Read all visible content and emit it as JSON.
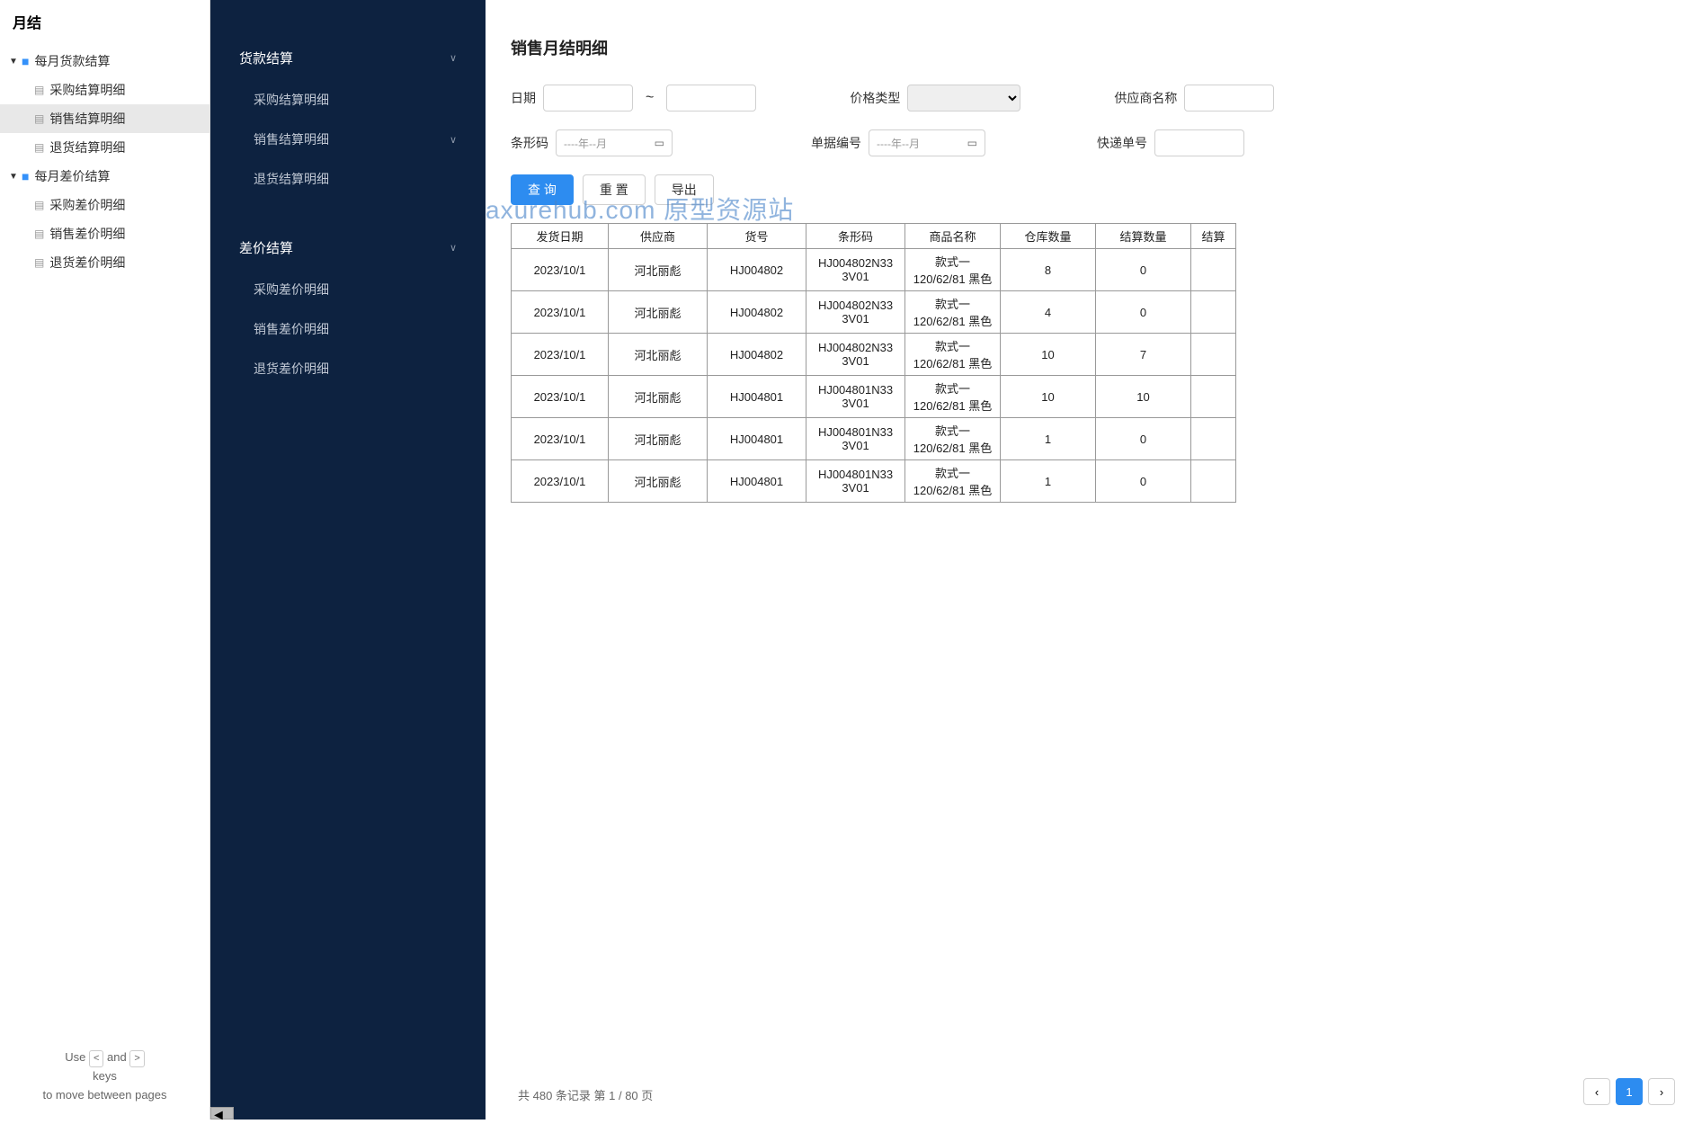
{
  "tree": {
    "title": "月结",
    "groups": [
      {
        "label": "每月货款结算",
        "items": [
          "采购结算明细",
          "销售结算明细",
          "退货结算明细"
        ]
      },
      {
        "label": "每月差价结算",
        "items": [
          "采购差价明细",
          "销售差价明细",
          "退货差价明细"
        ]
      }
    ],
    "footer": {
      "use": "Use",
      "and": "and",
      "keys": "keys",
      "hint": "to move between pages",
      "left": "<",
      "right": ">"
    }
  },
  "darkNav": {
    "section1": "货款结算",
    "items1": [
      "采购结算明细",
      "销售结算明细",
      "退货结算明细"
    ],
    "section2": "差价结算",
    "items2": [
      "采购差价明细",
      "销售差价明细",
      "退货差价明细"
    ]
  },
  "page": {
    "title": "销售月结明细",
    "filters": {
      "date": "日期",
      "tilde": "~",
      "priceType": "价格类型",
      "supplierName": "供应商名称",
      "barcode": "条形码",
      "barcodePh": "----年--月",
      "docNo": "单据编号",
      "docNoPh": "----年--月",
      "trackNo": "快递单号"
    },
    "buttons": {
      "query": "查 询",
      "reset": "重 置",
      "export": "导出"
    },
    "headers": [
      "发货日期",
      "供应商",
      "货号",
      "条形码",
      "商品名称",
      "仓库数量",
      "结算数量",
      "结算"
    ],
    "rows": [
      [
        "2023/10/1",
        "河北丽彪",
        "HJ004802",
        "HJ004802N333V01",
        "款式一 120/62/81 黑色",
        "8",
        "0"
      ],
      [
        "2023/10/1",
        "河北丽彪",
        "HJ004802",
        "HJ004802N333V01",
        "款式一 120/62/81 黑色",
        "4",
        "0"
      ],
      [
        "2023/10/1",
        "河北丽彪",
        "HJ004802",
        "HJ004802N333V01",
        "款式一 120/62/81 黑色",
        "10",
        "7"
      ],
      [
        "2023/10/1",
        "河北丽彪",
        "HJ004801",
        "HJ004801N333V01",
        "款式一 120/62/81 黑色",
        "10",
        "10"
      ],
      [
        "2023/10/1",
        "河北丽彪",
        "HJ004801",
        "HJ004801N333V01",
        "款式一 120/62/81 黑色",
        "1",
        "0"
      ],
      [
        "2023/10/1",
        "河北丽彪",
        "HJ004801",
        "HJ004801N333V01",
        "款式一 120/62/81 黑色",
        "1",
        "0"
      ]
    ],
    "watermark": "axurehub.com 原型资源站",
    "recordText": "共 480 条记录 第 1 / 80 页",
    "pager": "1"
  }
}
